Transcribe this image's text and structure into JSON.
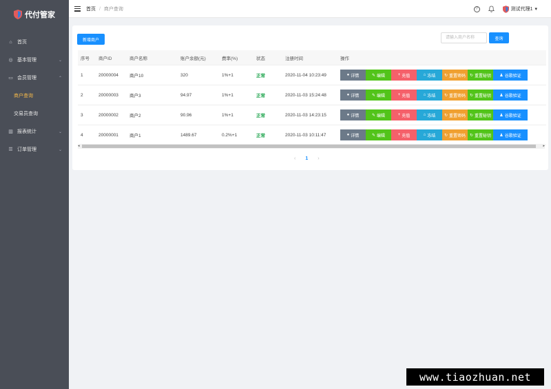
{
  "app": {
    "title": "代付管家"
  },
  "sidebar": {
    "items": [
      {
        "label": "首页",
        "icon": "home-icon"
      },
      {
        "label": "基本管理",
        "icon": "globe-icon"
      },
      {
        "label": "会员管理",
        "icon": "briefcase-icon"
      },
      {
        "label": "商户查询"
      },
      {
        "label": "交易员查询"
      },
      {
        "label": "报表统计",
        "icon": "bar-chart-icon"
      },
      {
        "label": "订单管理",
        "icon": "list-icon"
      }
    ],
    "active_color": "#f5b94a"
  },
  "header": {
    "breadcrumb": {
      "home": "首页",
      "separator": "/",
      "current": "商户查询"
    },
    "user": {
      "name": "测试代理1"
    }
  },
  "toolbar": {
    "add_label": "新增商户",
    "search_placeholder": "请输入商户名称",
    "search_label": "查询"
  },
  "table": {
    "headers": [
      "序号",
      "商户ID",
      "商户名称",
      "账户余额(元)",
      "费率(%)",
      "状态",
      "注册时间",
      "操作"
    ],
    "rows": [
      {
        "idx": "1",
        "id": "20000004",
        "name": "商户10",
        "balance": "320",
        "rate": "1%+1",
        "status": "正常",
        "time": "2020-11-04 10:23:49"
      },
      {
        "idx": "2",
        "id": "20000003",
        "name": "商户3",
        "balance": "94.97",
        "rate": "1%+1",
        "status": "正常",
        "time": "2020-11-03 15:24:48"
      },
      {
        "idx": "3",
        "id": "20000002",
        "name": "商户2",
        "balance": "90.96",
        "rate": "1%+1",
        "status": "正常",
        "time": "2020-11-03 14:23:15"
      },
      {
        "idx": "4",
        "id": "20000001",
        "name": "商户1",
        "balance": "1489.67",
        "rate": "0.2%+1",
        "status": "正常",
        "time": "2020-11-03 10:11:47"
      }
    ],
    "actions": {
      "detail": "详情",
      "edit": "编辑",
      "recharge": "充值",
      "freeze": "冻结",
      "reset_password": "重置密码",
      "reset_key": "重置秘钥",
      "google_verify": "谷歌验证"
    }
  },
  "pagination": {
    "prev": "‹",
    "current": "1",
    "next": "›"
  },
  "watermark": {
    "text": "www.tiaozhuan.net"
  },
  "colors": {
    "primary": "#1890ff",
    "sidebar_bg": "#4a4e57",
    "status_ok": "#1aa34a",
    "detail": "#6c7a89",
    "edit": "#52c41a",
    "recharge": "#f5606a",
    "freeze": "#27a8d8",
    "reset_password": "#f0a030",
    "reset_key": "#52c41a",
    "google_verify": "#1890ff"
  }
}
